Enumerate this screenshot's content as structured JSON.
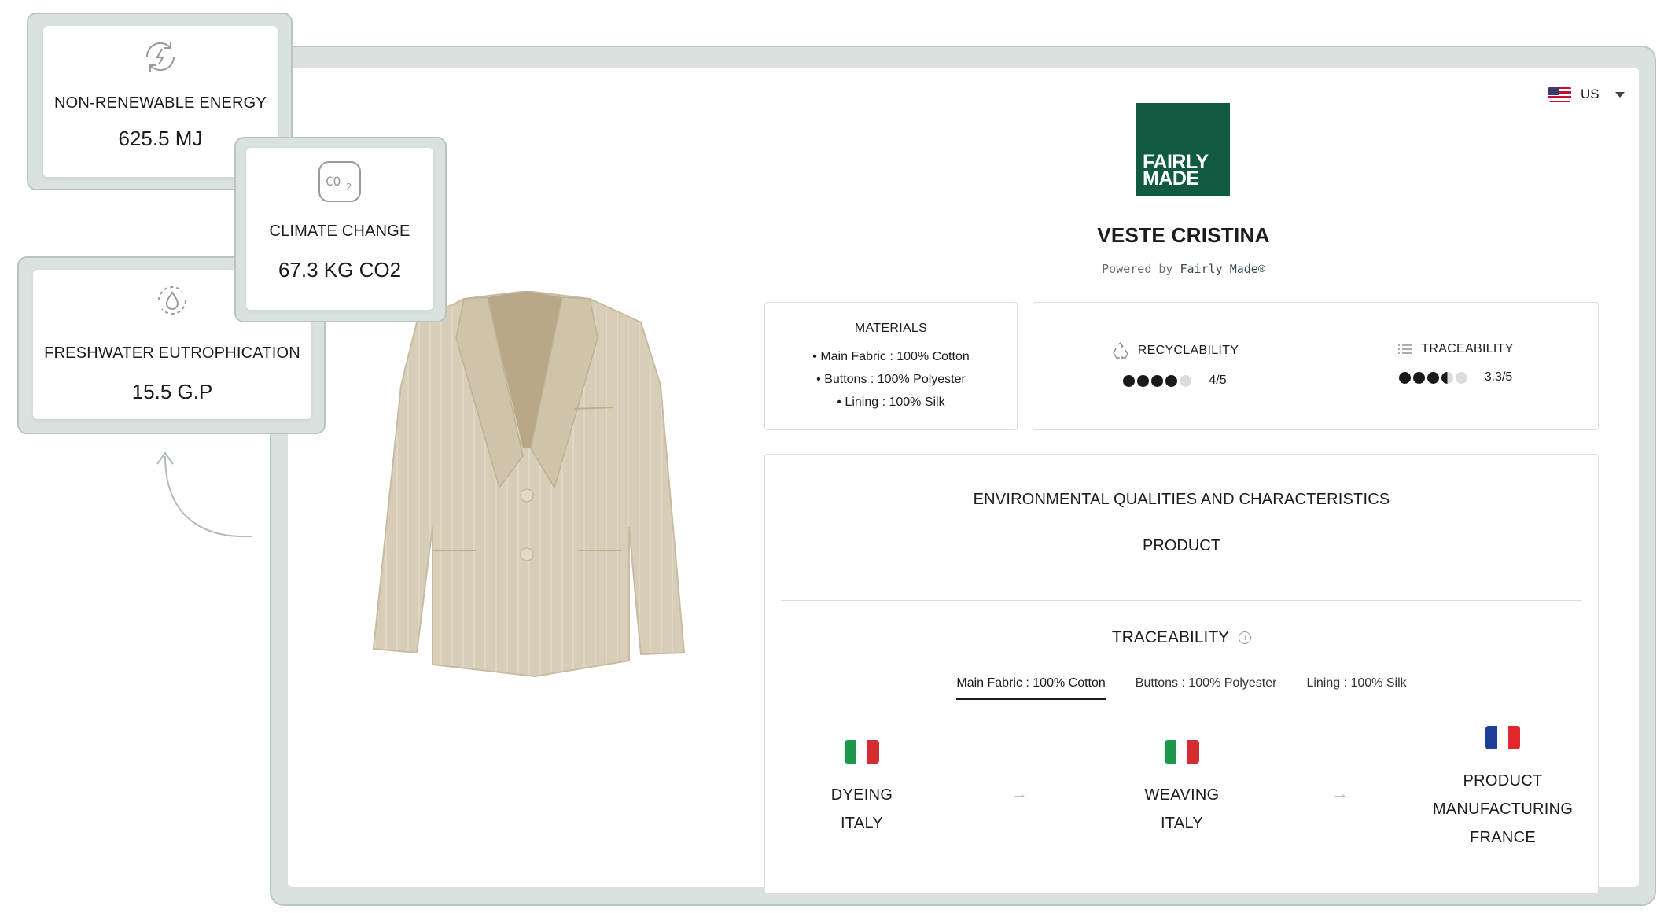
{
  "country": {
    "code": "US"
  },
  "brand": {
    "line1": "FAIRLY",
    "line2": "MADE"
  },
  "product": {
    "title": "VESTE CRISTINA",
    "powered_by_prefix": "Powered by",
    "powered_by_link": "Fairly Made®"
  },
  "materials": {
    "heading": "MATERIALS",
    "items": [
      "Main Fabric : 100% Cotton",
      "Buttons : 100% Polyester",
      "Lining : 100% Silk"
    ]
  },
  "scores": [
    {
      "label": "RECYCLABILITY",
      "value": "4/5",
      "rating": 4,
      "icon": "recycle-icon"
    },
    {
      "label": "TRACEABILITY",
      "value": "3.3/5",
      "rating": 3.3,
      "icon": "list-icon"
    }
  ],
  "environment": {
    "title": "ENVIRONMENTAL QUALITIES AND CHARACTERISTICS",
    "subtitle": "PRODUCT",
    "traceability_title": "TRACEABILITY",
    "tabs": [
      "Main Fabric : 100% Cotton",
      "Buttons : 100% Polyester",
      "Lining : 100% Silk"
    ],
    "active_tab": 0,
    "steps": [
      {
        "stage": "DYEING",
        "country": "ITALY",
        "flag": [
          "#1a9a49",
          "#ffffff",
          "#d52b33"
        ]
      },
      {
        "stage": "WEAVING",
        "country": "ITALY",
        "flag": [
          "#1a9a49",
          "#ffffff",
          "#d52b33"
        ]
      },
      {
        "stage_line1": "PRODUCT",
        "stage_line2": "MANUFACTURING",
        "country": "FRANCE",
        "flag": [
          "#1f3e9b",
          "#ffffff",
          "#e1262c"
        ]
      }
    ]
  },
  "impacts": [
    {
      "label": "NON-RENEWABLE ENERGY",
      "value": "625.5 MJ",
      "icon": "energy-icon"
    },
    {
      "label": "CLIMATE CHANGE",
      "value": "67.3 KG CO2",
      "icon": "co2-icon"
    },
    {
      "label": "FRESHWATER EUTROPHICATION",
      "value": "15.5 G.P",
      "icon": "water-drop-icon"
    }
  ],
  "colors": {
    "brand_green": "#0f5a41",
    "frame": "#d9e2de",
    "frame_border": "#b8c6c0"
  }
}
